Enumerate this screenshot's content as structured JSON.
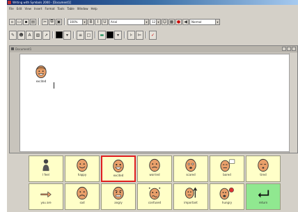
{
  "window": {
    "title": "Writing with Symbols 2000 - [Document1]"
  },
  "menu": [
    "File",
    "Edit",
    "View",
    "Insert",
    "Format",
    "Tools",
    "Table",
    "Window",
    "Help"
  ],
  "toolbar1": {
    "font_name": "Arial",
    "font_size": "12",
    "zoom": "100%",
    "style": "Normal"
  },
  "document": {
    "title": "Document1",
    "symbol_label": "excited"
  },
  "grid": {
    "row1": [
      "I feel",
      "happy",
      "excited",
      "worried",
      "scared",
      "bored",
      "tired"
    ],
    "row2": [
      "you are",
      "sad",
      "angry",
      "confused",
      "important",
      "hungry",
      "return"
    ]
  }
}
